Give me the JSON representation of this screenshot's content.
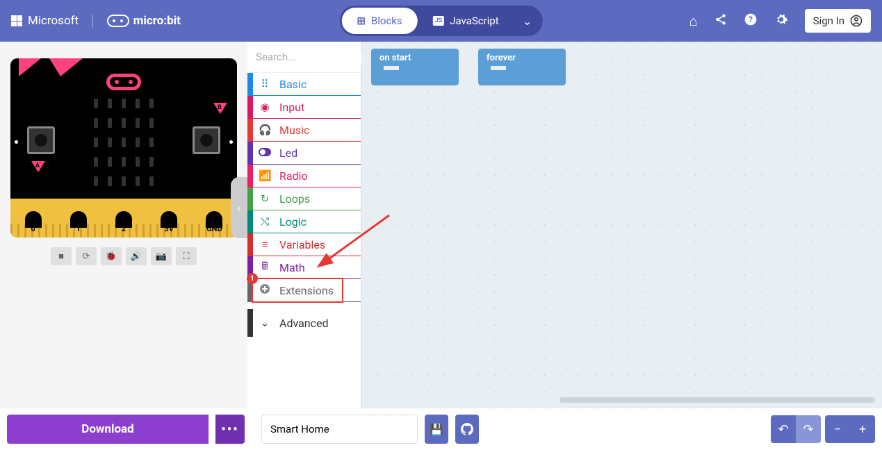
{
  "brand": {
    "ms": "Microsoft",
    "mb": "micro:bit"
  },
  "toggle": {
    "blocks": "Blocks",
    "js": "JavaScript"
  },
  "top": {
    "signin": "Sign In"
  },
  "search": {
    "placeholder": "Search..."
  },
  "cats": {
    "basic": "Basic",
    "input": "Input",
    "music": "Music",
    "led": "Led",
    "radio": "Radio",
    "loops": "Loops",
    "logic": "Logic",
    "vars": "Variables",
    "math": "Math",
    "ext": "Extensions",
    "adv": "Advanced"
  },
  "ext_badge": "1",
  "pins": {
    "p0": "0",
    "p1": "1",
    "p2": "2",
    "p3v": "3V",
    "gnd": "GND"
  },
  "blocks": {
    "onstart": "on start",
    "forever": "forever"
  },
  "footer": {
    "download": "Download",
    "project": "Smart Home"
  }
}
